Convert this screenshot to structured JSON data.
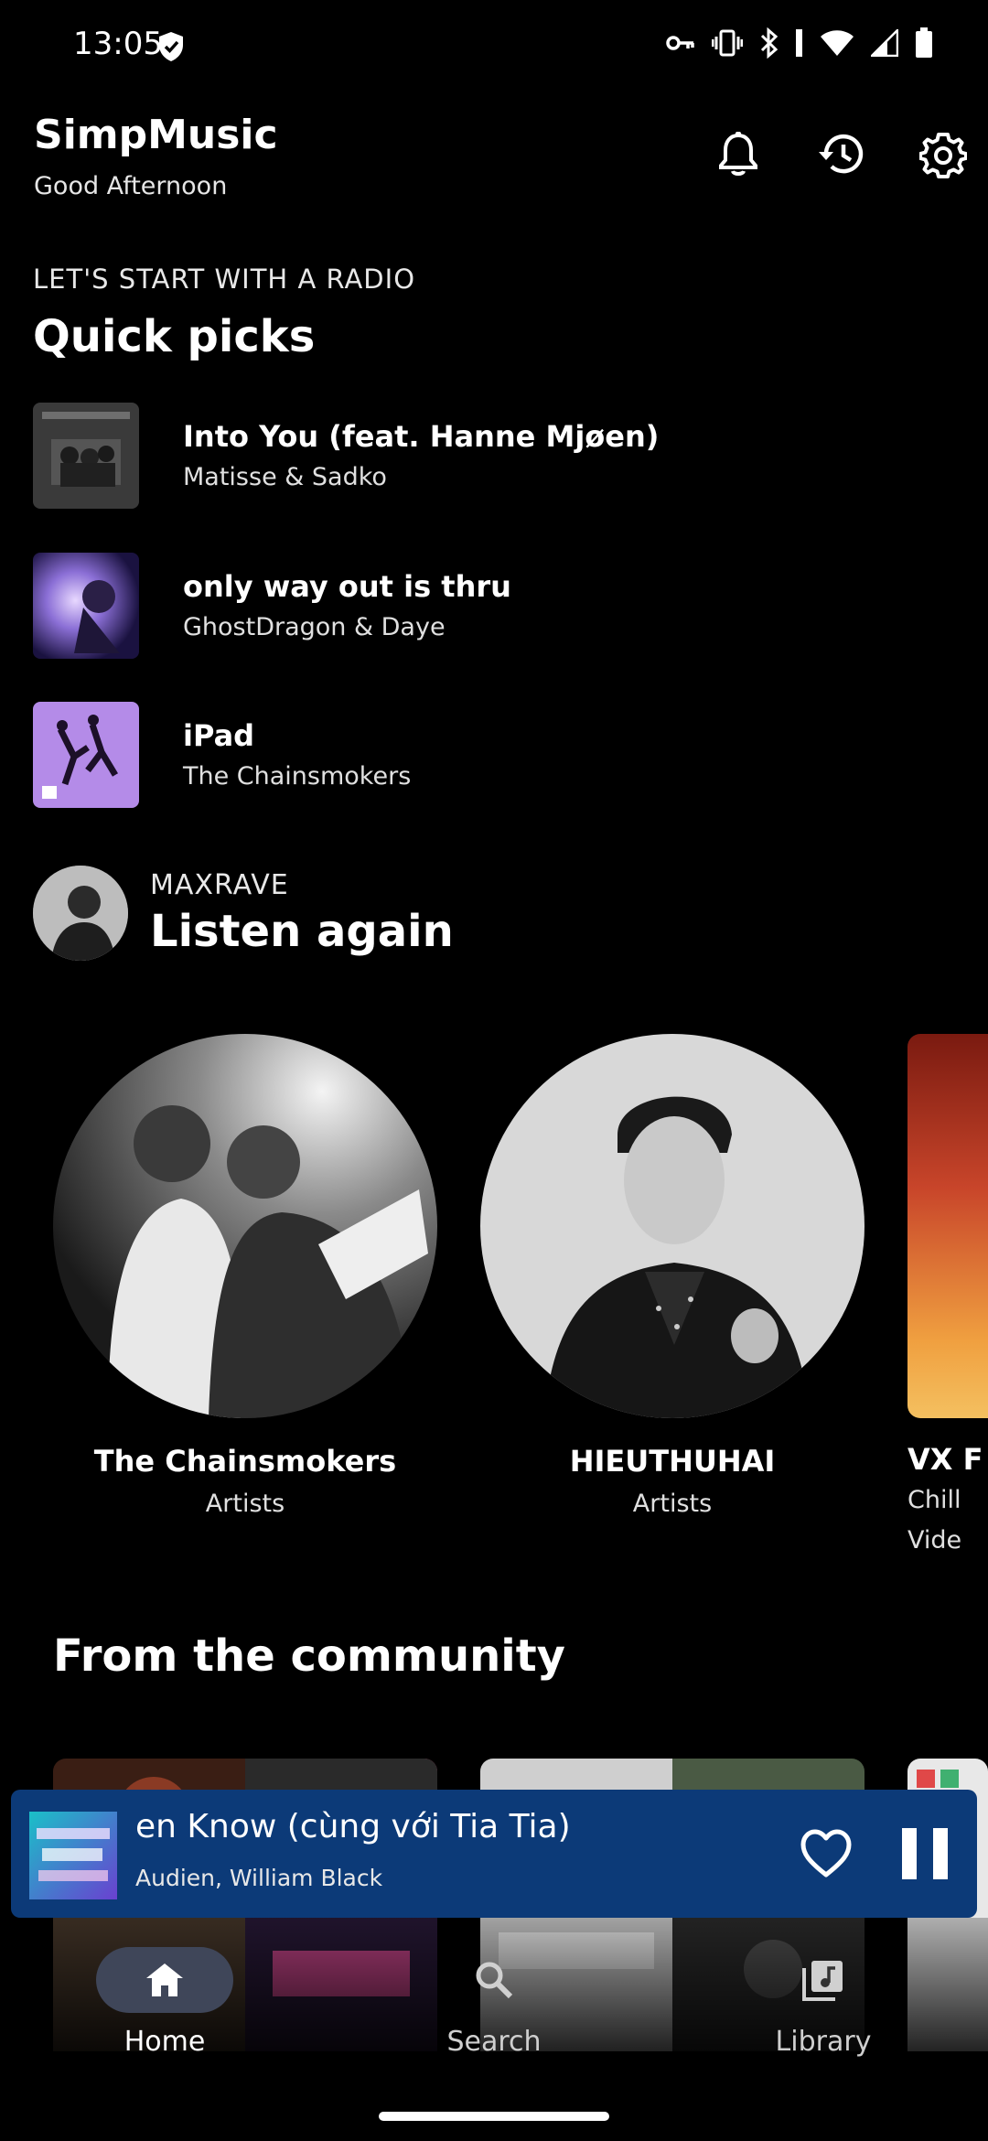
{
  "status_bar": {
    "time": "13:05"
  },
  "header": {
    "title": "SimpMusic",
    "greeting": "Good Afternoon",
    "actions": [
      "bell-icon",
      "history-icon",
      "settings-icon"
    ]
  },
  "quick_picks": {
    "eyebrow": "LET'S START WITH A RADIO",
    "title": "Quick picks",
    "items": [
      {
        "name": "Into You (feat. Hanne Mjøen)",
        "artist": "Matisse & Sadko"
      },
      {
        "name": "only way out is thru",
        "artist": "GhostDragon & Daye"
      },
      {
        "name": "iPad",
        "artist": "The Chainsmokers"
      }
    ]
  },
  "listen_again": {
    "eyebrow": "MAXRAVE",
    "title": "Listen again",
    "items": [
      {
        "name": "The Chainsmokers",
        "type": "Artists"
      },
      {
        "name": "HIEUTHUHAI",
        "type": "Artists"
      },
      {
        "name": "VX F",
        "type": "Chill",
        "extra": "Vide"
      }
    ]
  },
  "community": {
    "title": "From the community"
  },
  "player": {
    "title": "en Know (cùng với Tia Tia)",
    "artists": "Audien, William Black",
    "accent": "#0c3a78"
  },
  "nav": {
    "items": [
      {
        "label": "Home",
        "active": true
      },
      {
        "label": "Search",
        "active": false
      },
      {
        "label": "Library",
        "active": false
      }
    ]
  }
}
